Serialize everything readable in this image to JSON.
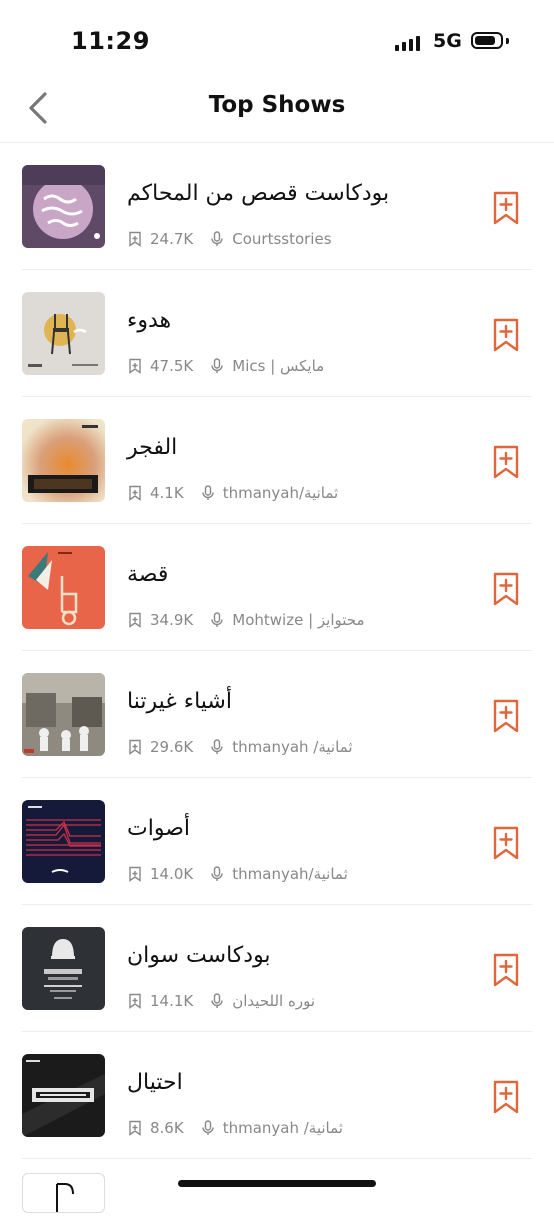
{
  "status": {
    "time": "11:29",
    "network": "5G"
  },
  "nav": {
    "title": "Top Shows",
    "back_icon": "chevron-left-icon"
  },
  "accent_color": "#E0673C",
  "shows": [
    {
      "title": "بودكاست قصص من المحاكم",
      "count": "24.7K",
      "author": "Courtsstories"
    },
    {
      "title": "هدوء",
      "count": "47.5K",
      "author": "مايكس | Mics"
    },
    {
      "title": "الفجر",
      "count": "4.1K",
      "author": "ثمانية/thmanyah"
    },
    {
      "title": "قصة",
      "count": "34.9K",
      "author": "محتوايز | Mohtwize"
    },
    {
      "title": "أشياء غيرتنا",
      "count": "29.6K",
      "author": "ثمانية/ thmanyah"
    },
    {
      "title": "أصوات",
      "count": "14.0K",
      "author": "ثمانية/thmanyah"
    },
    {
      "title": "بودكاست سوان",
      "count": "14.1K",
      "author": "نوره اللحيدان"
    },
    {
      "title": "احتيال",
      "count": "8.6K",
      "author": "ثمانية/ thmanyah"
    }
  ]
}
